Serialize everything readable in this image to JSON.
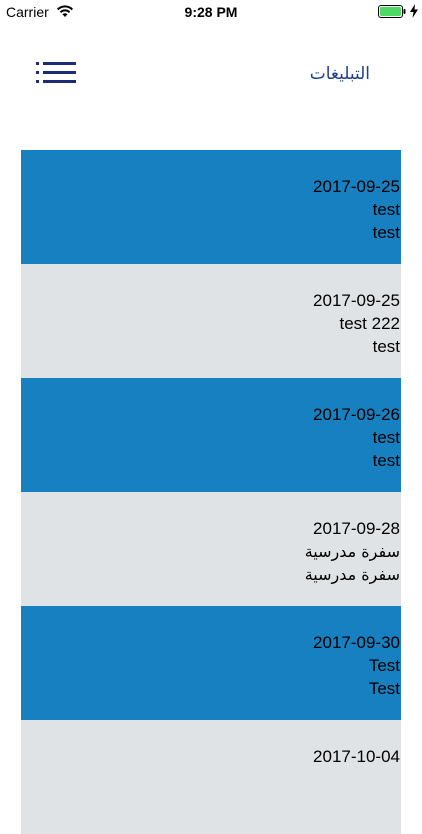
{
  "status_bar": {
    "carrier": "Carrier",
    "time": "9:28 PM",
    "icons": [
      "wifi-icon",
      "battery-icon",
      "charging-bolt-icon"
    ],
    "battery_color": "#4cd964"
  },
  "header": {
    "title": "التبليغات",
    "menu_icon": "hamburger-menu-icon",
    "title_color": "#1d3f8f"
  },
  "colors": {
    "blue_row": "#1680c0",
    "gray_row": "#e0e3e5"
  },
  "notifications": [
    {
      "date": "2017-09-25",
      "title": "test",
      "body": "test"
    },
    {
      "date": "2017-09-25",
      "title": "test 222",
      "body": "test"
    },
    {
      "date": "2017-09-26",
      "title": "test",
      "body": "test"
    },
    {
      "date": "2017-09-28",
      "title": "سفرة مدرسية",
      "body": "سفرة مدرسية"
    },
    {
      "date": "2017-09-30",
      "title": "Test",
      "body": "Test"
    },
    {
      "date": "2017-10-04",
      "title": "",
      "body": ""
    }
  ]
}
